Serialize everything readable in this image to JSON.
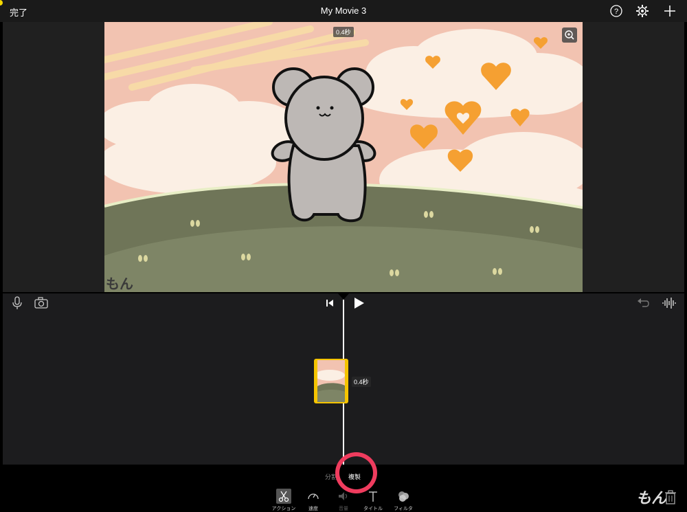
{
  "header": {
    "done_label": "完了",
    "project_title": "My Movie 3"
  },
  "icons": {
    "help": "help-circle-icon",
    "settings": "gear-icon",
    "add": "plus-icon",
    "zoom": "zoom-icon",
    "mic": "microphone-icon",
    "camera": "camera-icon",
    "skip_start": "skip-to-start-icon",
    "play": "play-icon",
    "undo": "undo-icon",
    "waveform": "waveform-icon",
    "trash": "trash-icon"
  },
  "viewer": {
    "duration": "0.4秒",
    "canvas_signature": "もん"
  },
  "timeline": {
    "clip_duration": "0.4秒"
  },
  "action_menu": {
    "split_label": "分割",
    "duplicate_label": "複製"
  },
  "toolbar": {
    "tools": [
      {
        "label": "アクション",
        "icon": "scissors-icon"
      },
      {
        "label": "速度",
        "icon": "speedometer-icon"
      },
      {
        "label": "音量",
        "icon": "speaker-icon"
      },
      {
        "label": "タイトル",
        "icon": "title-T-icon"
      },
      {
        "label": "フィルタ",
        "icon": "filter-icon"
      }
    ]
  },
  "watermark": "もん",
  "colors": {
    "clip_border": "#f5c400",
    "highlight_circle": "#ef3c5e",
    "sky": "#f2c3b1",
    "hill": "#7d8466"
  }
}
